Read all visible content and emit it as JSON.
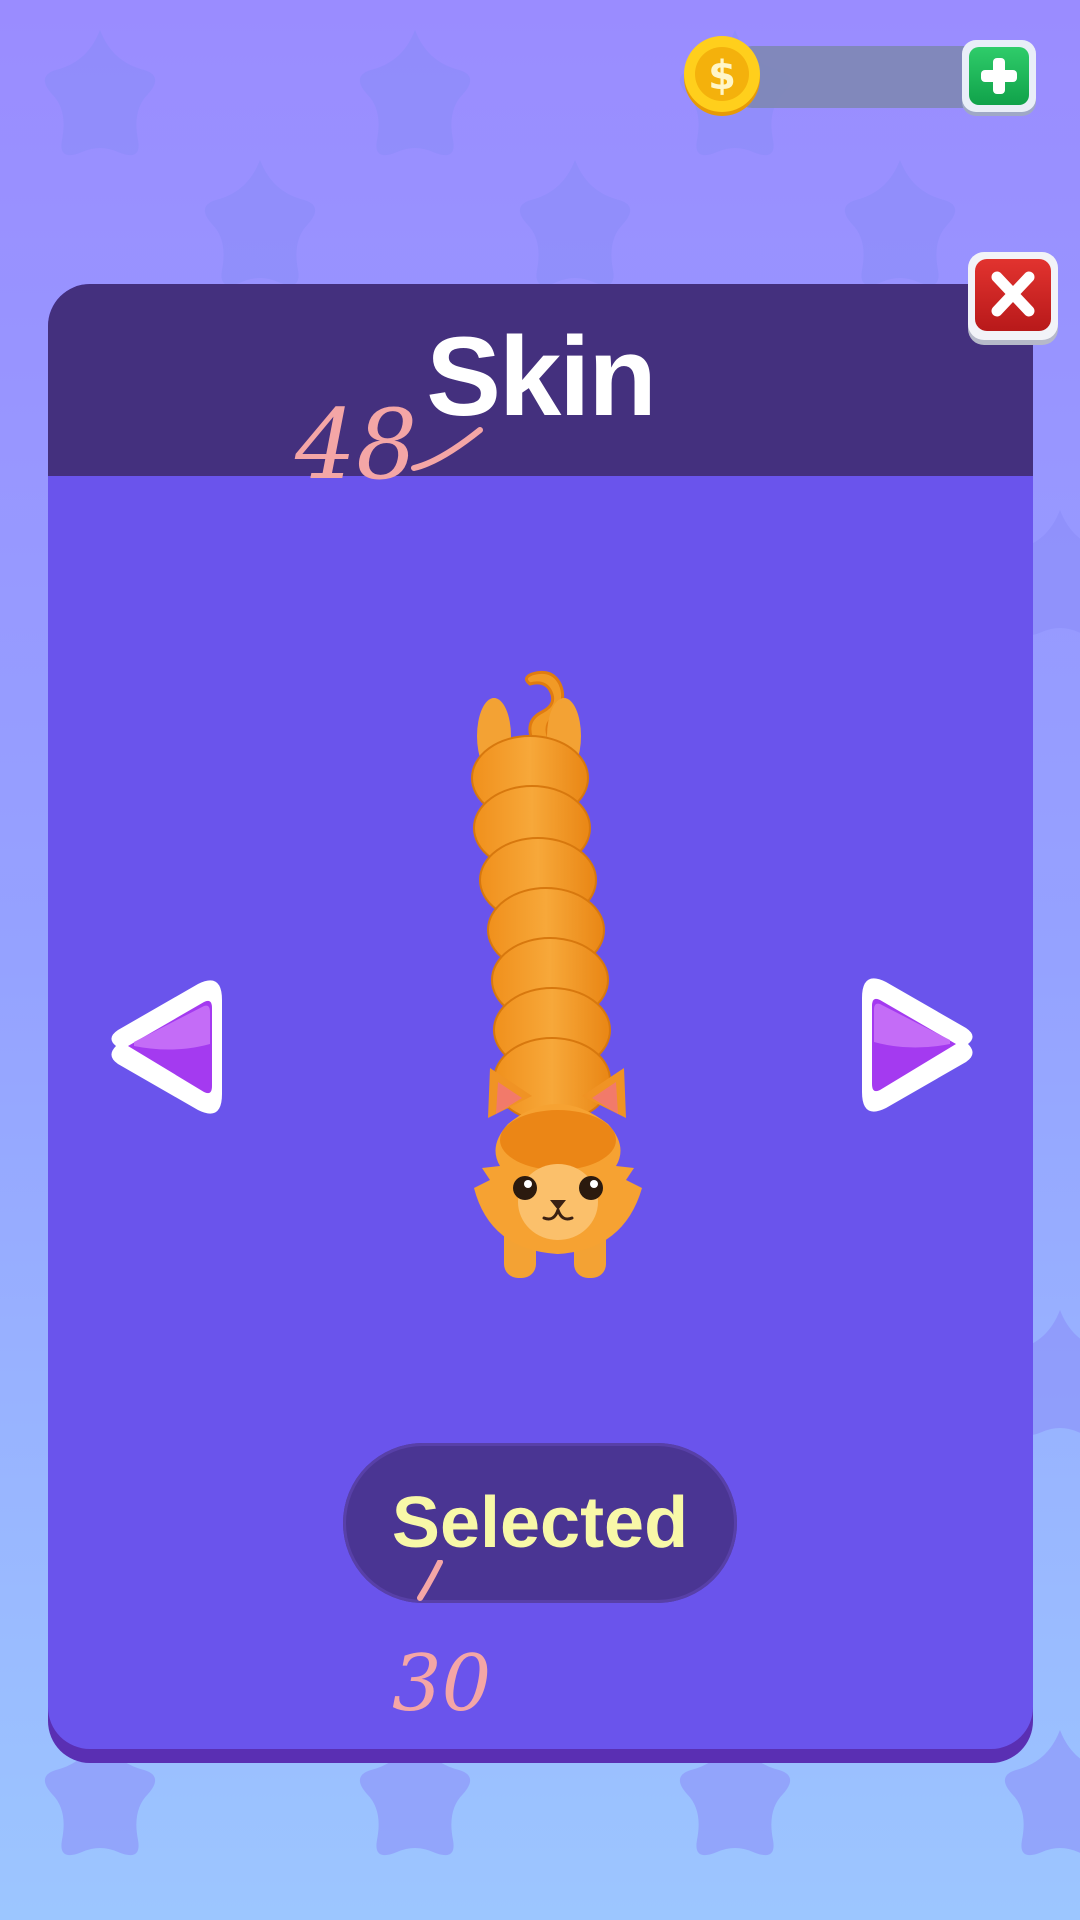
{
  "topbar": {
    "coin_icon": "dollar-coin-icon",
    "coin_amount": "",
    "add_icon": "plus-icon"
  },
  "dialog": {
    "title": "Skin",
    "close_icon": "close-x-icon",
    "prev_icon": "left-arrow-icon",
    "next_icon": "right-arrow-icon",
    "preview": "orange-cat-skin",
    "action_label": "Selected"
  },
  "annotations": {
    "top_note": "48",
    "bottom_note": "30"
  },
  "colors": {
    "panel": "#6a54ec",
    "header": "#44307e",
    "button": "#4a3593",
    "button_text": "#f8f8a8",
    "annotation": "#f4a6a6"
  }
}
